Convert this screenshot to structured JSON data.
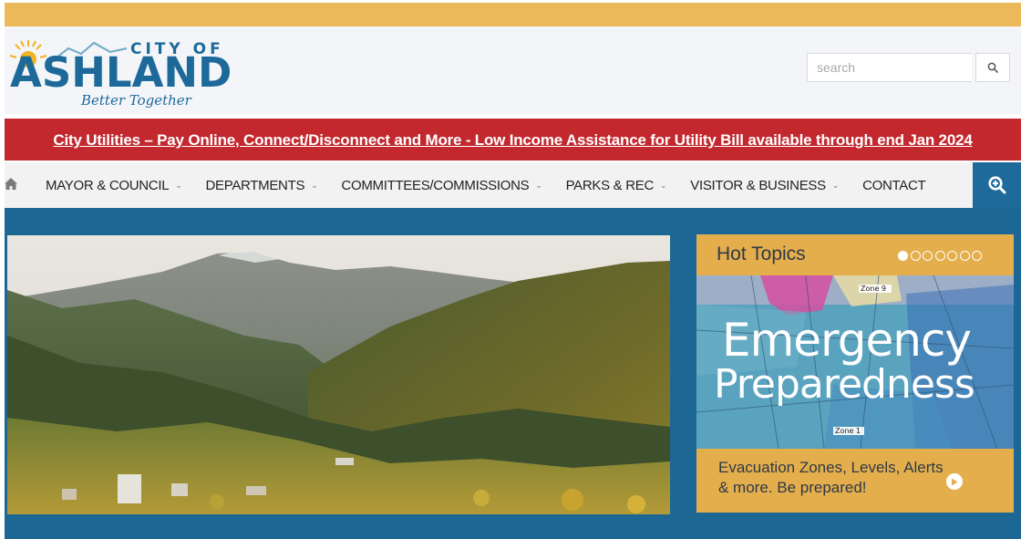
{
  "logo": {
    "city_of": "CITY OF",
    "name": "ASHLAND",
    "tagline": "Better Together"
  },
  "search": {
    "placeholder": "search"
  },
  "alert": {
    "text": "City Utilities – Pay Online, Connect/Disconnect and More - Low Income Assistance for Utility Bill available through end Jan 2024"
  },
  "nav": {
    "items": [
      {
        "label": "MAYOR & COUNCIL"
      },
      {
        "label": "DEPARTMENTS"
      },
      {
        "label": "COMMITTEES/COMMISSIONS"
      },
      {
        "label": "PARKS & REC"
      },
      {
        "label": "VISITOR & BUSINESS"
      },
      {
        "label": "CONTACT"
      }
    ]
  },
  "hot_topics": {
    "title": "Hot Topics",
    "slide_count": 7,
    "active_slide": 1,
    "headline_1": "Emergency",
    "headline_2": "Preparedness",
    "caption": "Evacuation Zones, Levels, Alerts & more. Be prepared!",
    "map_label_zone9": "Zone 9",
    "map_label_zone1": "Zone 1"
  },
  "colors": {
    "top_bar": "#ebb95a",
    "alert_bar": "#c3282f",
    "main_bg": "#1d6794",
    "hot_topics_bg": "#e5ae4d",
    "brand_blue": "#1d6a9a"
  },
  "icons": {
    "home": "home-icon",
    "search": "search-icon",
    "zoom": "zoom-in-icon",
    "play": "play-icon"
  }
}
